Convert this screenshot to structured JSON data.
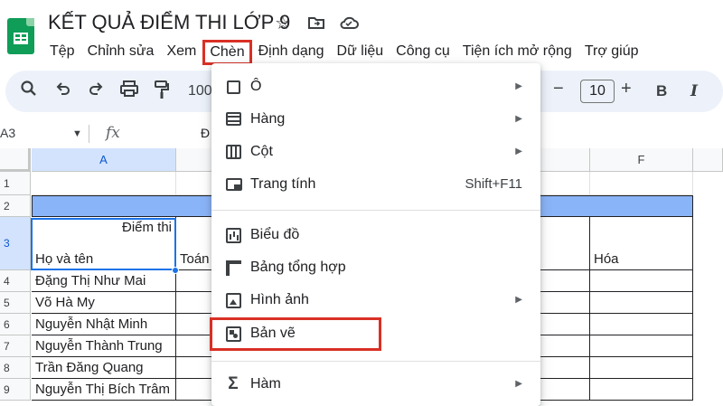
{
  "document": {
    "title": "KẾT QUẢ ĐIỂM THI LỚP 9"
  },
  "title_icons": [
    "star-icon",
    "move-folder-icon",
    "cloud-status-icon"
  ],
  "menubar": {
    "items": [
      {
        "label": "Tệp",
        "active": false
      },
      {
        "label": "Chỉnh sửa",
        "active": false
      },
      {
        "label": "Xem",
        "active": false
      },
      {
        "label": "Chèn",
        "active": true
      },
      {
        "label": "Định dạng",
        "active": false
      },
      {
        "label": "Dữ liệu",
        "active": false
      },
      {
        "label": "Công cụ",
        "active": false
      },
      {
        "label": "Tiện ích mở rộng",
        "active": false
      },
      {
        "label": "Trợ giúp",
        "active": false
      }
    ]
  },
  "toolbar": {
    "zoom_partial": "100",
    "font_size": "10",
    "decrease_symbol": "−",
    "increase_symbol": "+",
    "bold_label": "B",
    "italic_label": "I"
  },
  "formula_bar": {
    "name_box": "A3",
    "fx_label": "fx",
    "value_partial": "Đ"
  },
  "grid": {
    "column_headers": [
      "A",
      "F"
    ],
    "row_headers": [
      "1",
      "2",
      "3",
      "4",
      "5",
      "6",
      "7",
      "8",
      "9"
    ],
    "header_cell_top": "Điểm thi",
    "header_cell_bottom": "Họ và tên",
    "col_b_header_partial": "Toán",
    "col_f_header": "Hóa",
    "students": [
      "Đặng Thị Như Mai",
      "Võ Hà My",
      "Nguyễn Nhật Minh",
      "Nguyễn Thành Trung",
      "Trần Đăng Quang",
      "Nguyễn Thị Bích Trâm"
    ]
  },
  "insert_menu": {
    "items": [
      {
        "label": "Ô",
        "icon": "cell-icon",
        "has_submenu": true,
        "shortcut": ""
      },
      {
        "label": "Hàng",
        "icon": "rows-icon",
        "has_submenu": true,
        "shortcut": ""
      },
      {
        "label": "Cột",
        "icon": "columns-icon",
        "has_submenu": true,
        "shortcut": ""
      },
      {
        "label": "Trang tính",
        "icon": "sheet-icon",
        "has_submenu": false,
        "shortcut": "Shift+F11"
      },
      {
        "label": "Biểu đồ",
        "icon": "chart-icon",
        "has_submenu": false,
        "shortcut": ""
      },
      {
        "label": "Bảng tổng hợp",
        "icon": "pivot-table-icon",
        "has_submenu": false,
        "shortcut": ""
      },
      {
        "label": "Hình ảnh",
        "icon": "image-icon",
        "has_submenu": true,
        "shortcut": ""
      },
      {
        "label": "Bản vẽ",
        "icon": "drawing-icon",
        "has_submenu": false,
        "shortcut": "",
        "highlighted": true
      },
      {
        "label": "Hàm",
        "icon": "function-icon",
        "has_submenu": true,
        "shortcut": ""
      }
    ]
  },
  "colors": {
    "highlight_box": "#d93025",
    "selection": "#1a73e8",
    "title_band": "#8ab4f8",
    "toolbar_bg": "#edf2fa",
    "logo_green": "#0f9d58"
  }
}
